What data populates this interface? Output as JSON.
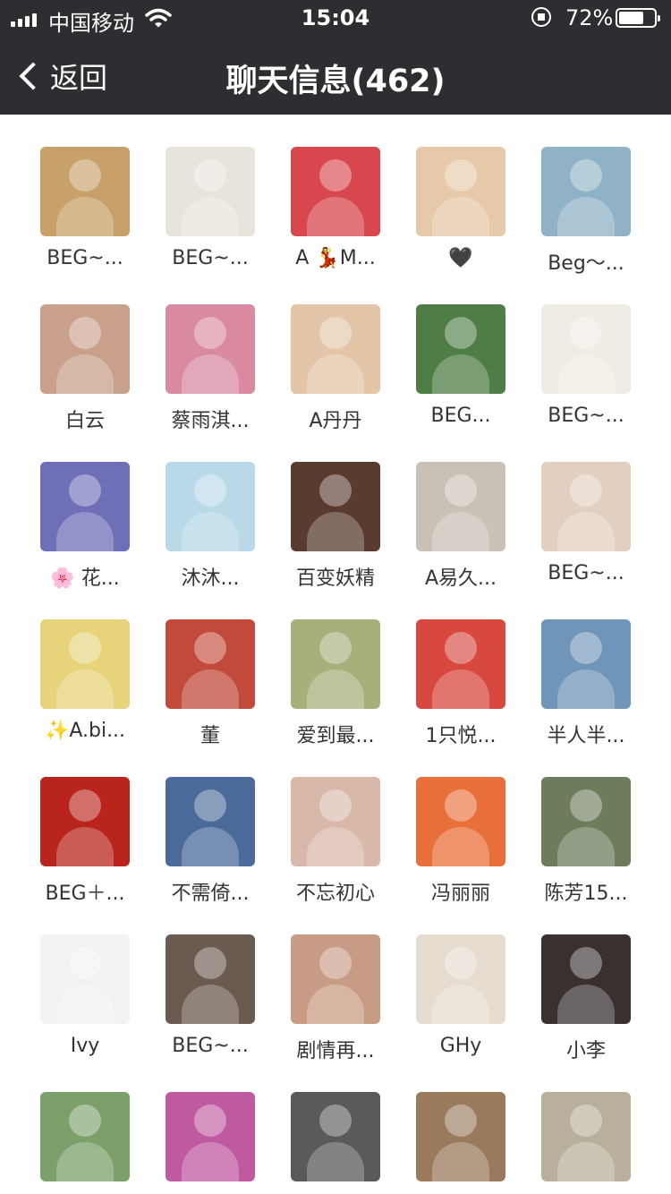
{
  "status_bar": {
    "carrier": "中国移动",
    "time": "15:04",
    "battery_percent": "72%",
    "battery_level": 0.72,
    "icons": [
      "signal-icon",
      "wifi-icon",
      "orientation-lock-icon",
      "battery-icon"
    ]
  },
  "header": {
    "back_label": "返回",
    "title": "聊天信息(462)"
  },
  "members": [
    {
      "name": "BEG~...",
      "color": "#c8a06a"
    },
    {
      "name": "BEG~...",
      "color": "#e8e4dc"
    },
    {
      "name": "A 💃M...",
      "color": "#d8474d"
    },
    {
      "name": "🖤",
      "color": "#e6c9a8"
    },
    {
      "name": "Beg～...",
      "color": "#8fb2c6"
    },
    {
      "name": "白云",
      "color": "#c9a08c"
    },
    {
      "name": "蔡雨淇...",
      "color": "#d98aa0"
    },
    {
      "name": "A丹丹",
      "color": "#e3c6a8"
    },
    {
      "name": "BEG...",
      "color": "#4e7d45"
    },
    {
      "name": "BEG~...",
      "color": "#f0ebe3"
    },
    {
      "name": "🌸 花...",
      "color": "#6f6fb8"
    },
    {
      "name": "沐沐...",
      "color": "#b9d9e8"
    },
    {
      "name": "百变妖精",
      "color": "#5a3b30"
    },
    {
      "name": "A易久...",
      "color": "#c9c1b6"
    },
    {
      "name": "BEG~...",
      "color": "#e2cfc0"
    },
    {
      "name": "✨A.bi...",
      "color": "#e7d37a"
    },
    {
      "name": "董",
      "color": "#c24a3a"
    },
    {
      "name": "爱到最...",
      "color": "#a7b07a"
    },
    {
      "name": "1只悦...",
      "color": "#d8483e"
    },
    {
      "name": "半人半...",
      "color": "#6f95b8"
    },
    {
      "name": "BEG＋...",
      "color": "#b9241c"
    },
    {
      "name": "不需倚...",
      "color": "#4a6a9a"
    },
    {
      "name": "不忘初心",
      "color": "#d8b8a8"
    },
    {
      "name": "冯丽丽",
      "color": "#e86f3a"
    },
    {
      "name": "陈芳15...",
      "color": "#6e7c5c"
    },
    {
      "name": "Ivy",
      "color": "#f2f2f2"
    },
    {
      "name": "BEG~...",
      "color": "#6b5a4f"
    },
    {
      "name": "剧情再...",
      "color": "#c89c84"
    },
    {
      "name": "GHy",
      "color": "#e6dcd0"
    },
    {
      "name": "小李",
      "color": "#3a3030"
    },
    {
      "name": "",
      "color": "#7ba06a"
    },
    {
      "name": "",
      "color": "#c05aa0"
    },
    {
      "name": "",
      "color": "#5a5a5a"
    },
    {
      "name": "",
      "color": "#9a7a5c"
    },
    {
      "name": "",
      "color": "#b8b09a"
    }
  ]
}
